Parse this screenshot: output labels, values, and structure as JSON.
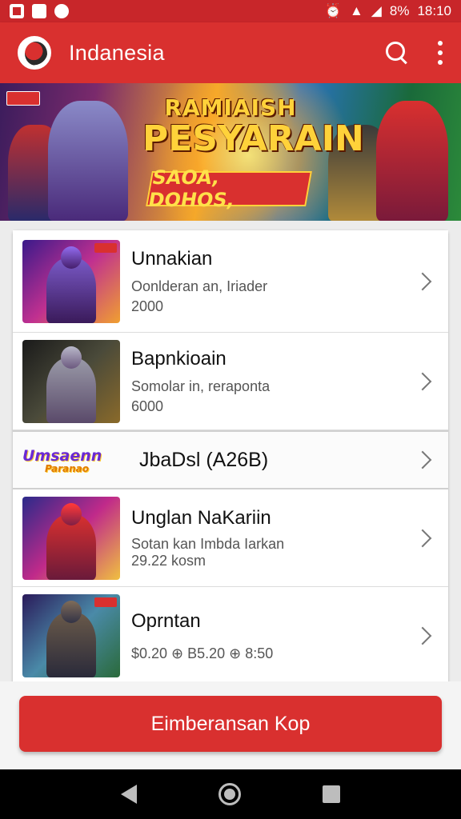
{
  "status_bar": {
    "battery": "8%",
    "time": "18:10"
  },
  "app_bar": {
    "title": "Indanesia",
    "icons": [
      "search-icon",
      "more-vert-icon"
    ]
  },
  "banner": {
    "title_line1": "RAMIAISH",
    "title_line2": "PESYARAIN",
    "ribbon": "SAOA, DOHOS,"
  },
  "list": {
    "items": [
      {
        "title": "Unnakian",
        "subtitle": "Oonlderan an, Iriader",
        "number": "2000"
      },
      {
        "title": "Bapnkioain",
        "subtitle": "Somolar in, reraponta",
        "number": "6000"
      },
      {
        "title": "JbaDsl (A26B)",
        "logo_text": "Umsaenn",
        "logo_sub": "Paranao"
      },
      {
        "title": "Unglan NaKariin",
        "subtitle": "Sotan kan Imbda Iarkan",
        "number": "29.22 kosm"
      },
      {
        "title": "Oprntan",
        "subtitle": "$0.20 ⊕ B5.20 ⊕ 8:50"
      }
    ]
  },
  "cta": {
    "label": "Eimberansan Kop"
  },
  "colors": {
    "primary": "#d9302f",
    "status_bar": "#c8262a",
    "background": "#ececec"
  }
}
